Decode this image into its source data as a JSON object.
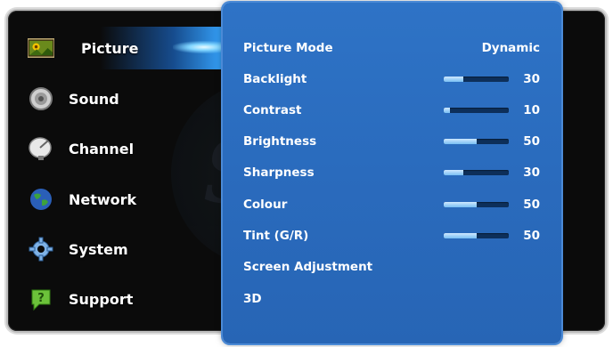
{
  "sidebar": {
    "items": [
      {
        "label": "Picture",
        "icon": "picture-icon",
        "active": true
      },
      {
        "label": "Sound",
        "icon": "speaker-icon"
      },
      {
        "label": "Channel",
        "icon": "satellite-dish-icon"
      },
      {
        "label": "Network",
        "icon": "globe-icon"
      },
      {
        "label": "System",
        "icon": "gear-icon"
      },
      {
        "label": "Support",
        "icon": "help-icon"
      }
    ]
  },
  "panel": {
    "picture_mode": {
      "label": "Picture Mode",
      "value": "Dynamic"
    },
    "sliders": [
      {
        "label": "Backlight",
        "value": "30",
        "level": 0.3
      },
      {
        "label": "Contrast",
        "value": "10",
        "level": 0.1
      },
      {
        "label": "Brightness",
        "value": "50",
        "level": 0.5
      },
      {
        "label": "Sharpness",
        "value": "30",
        "level": 0.3
      },
      {
        "label": "Colour",
        "value": "50",
        "level": 0.5
      },
      {
        "label": "Tint (G/R)",
        "value": "50",
        "level": 0.5
      }
    ],
    "links": [
      {
        "label": "Screen Adjustment"
      },
      {
        "label": "3D"
      }
    ]
  },
  "colors": {
    "panel": "#2e73c6",
    "highlight": "#37a6ff",
    "frame": "#0b0b0b"
  }
}
